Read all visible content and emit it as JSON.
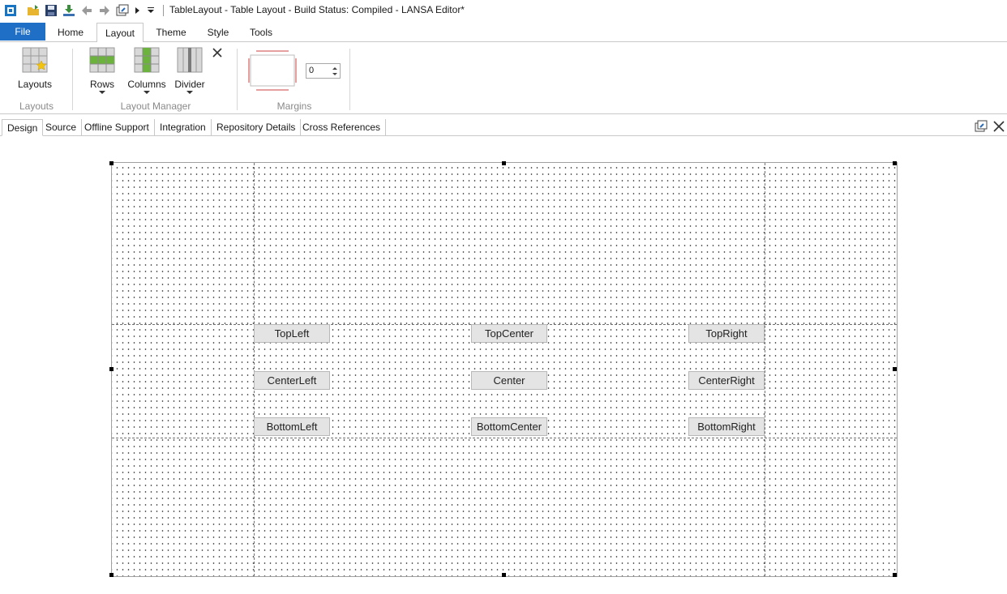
{
  "window": {
    "title": "TableLayout - Table Layout -   Build Status: Compiled - LANSA Editor*"
  },
  "quick_access": {
    "icons": [
      "app-icon",
      "open-folder-icon",
      "save-icon",
      "install-icon",
      "back-arrow-icon",
      "forward-arrow-icon",
      "window-icon",
      "play-icon",
      "dropdown-icon"
    ]
  },
  "ribbon": {
    "tabs": {
      "file": "File",
      "home": "Home",
      "layout": "Layout",
      "theme": "Theme",
      "style": "Style",
      "tools": "Tools"
    },
    "layouts_group": {
      "layouts_label": "Layouts",
      "group_label": "Layouts"
    },
    "layout_manager_group": {
      "rows_label": "Rows",
      "columns_label": "Columns",
      "divider_label": "Divider",
      "group_label": "Layout Manager"
    },
    "margins_group": {
      "value": "0",
      "group_label": "Margins"
    }
  },
  "doc_tabs": {
    "design": "Design",
    "source": "Source",
    "offline_support": "Offline Support",
    "integration": "Integration",
    "repository_details": "Repository Details",
    "cross_references": "Cross References"
  },
  "canvas": {
    "buttons": {
      "top_left": "TopLeft",
      "top_center": "TopCenter",
      "top_right": "TopRight",
      "center_left": "CenterLeft",
      "center": "Center",
      "center_right": "CenterRight",
      "bottom_left": "BottomLeft",
      "bottom_center": "BottomCenter",
      "bottom_right": "BottomRight"
    }
  },
  "colors": {
    "file_tab": "#1f6fc6",
    "row_icon_green": "#6cb33e",
    "margin_preview_red": "#e6a0a0"
  }
}
